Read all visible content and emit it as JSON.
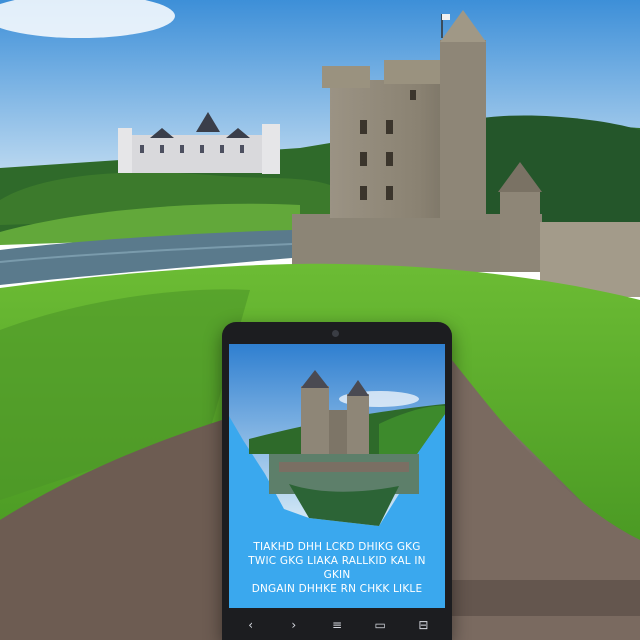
{
  "scene": {
    "sky_color": "#4a9fe0",
    "grass_color": "#5fae2c",
    "road_color": "#7a6a60",
    "castle_stone_color": "#8e8677"
  },
  "phone": {
    "screen_color": "#3aa8ee",
    "caption_lines": [
      "TIAKHD DHH LCKD DHIKG GKG",
      "TWIC GKG LIAKA RALLKID KAL IN GKIN",
      "DNGAIN DHHKE RN CHKK LIKLE"
    ],
    "nav_icons": [
      {
        "name": "back-icon",
        "glyph": "‹"
      },
      {
        "name": "forward-icon",
        "glyph": "›"
      },
      {
        "name": "menu-icon",
        "glyph": "≡"
      },
      {
        "name": "home-icon",
        "glyph": "▭"
      },
      {
        "name": "recent-apps-icon",
        "glyph": "⊟"
      }
    ]
  }
}
